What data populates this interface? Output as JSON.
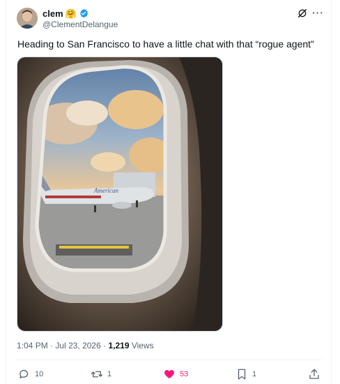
{
  "author": {
    "name": "clem",
    "emoji": "🤗",
    "handle": "@ClementDelangue"
  },
  "tweet": {
    "text": "Heading to San Francisco to have a little chat with that “rogue agent”",
    "time": "1:04 PM",
    "date": "Jul 23, 2026",
    "views_count": "1,219",
    "views_label": "Views"
  },
  "actions": {
    "replies": "10",
    "reposts": "1",
    "likes": "53",
    "bookmarks": "1"
  },
  "colors": {
    "like": "#f91880",
    "verified": "#1d9bf0",
    "muted": "#536471"
  },
  "icons": [
    "grok-icon",
    "more-icon",
    "verified-icon",
    "reply-icon",
    "repost-icon",
    "heart-icon",
    "bookmark-icon",
    "share-icon"
  ]
}
